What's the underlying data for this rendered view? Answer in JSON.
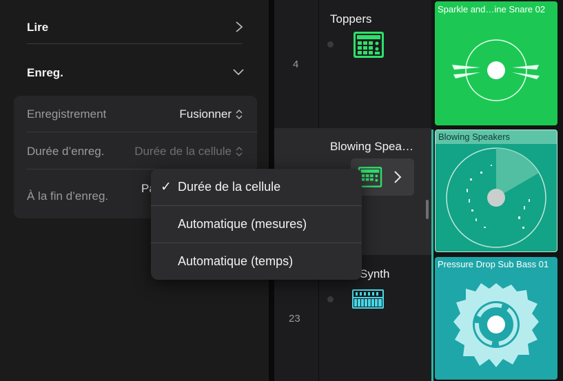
{
  "inspector": {
    "play_label": "Lire",
    "record_label": "Enreg.",
    "recording": {
      "label": "Enregistrement",
      "value": "Fusionner"
    },
    "duration": {
      "label": "Durée d’enreg.",
      "value": "Durée de la cellule"
    },
    "end": {
      "label": "À la fin d’enreg.",
      "value_partial": "Pa"
    }
  },
  "popup": {
    "options": [
      {
        "label": "Durée de la cellule",
        "checked": true
      },
      {
        "label": "Automatique (mesures)",
        "checked": false
      },
      {
        "label": "Automatique (temps)",
        "checked": false
      }
    ],
    "check_glyph": "✓"
  },
  "tracks": [
    {
      "number": "4",
      "name": "Toppers",
      "icon": "drum-machine-icon"
    },
    {
      "number": "",
      "name": "Blowing Spea…",
      "icon": "drum-machine-icon"
    },
    {
      "number": "23",
      "name": "Synth",
      "icon": "synth-keyboard-icon"
    }
  ],
  "cells": [
    {
      "title": "Sparkle and…ine Snare 02",
      "color": "#1cc853"
    },
    {
      "title": "Blowing Speakers",
      "color": "#13a386"
    },
    {
      "title": "Pressure Drop Sub Bass 01",
      "color": "#1fa6a9"
    }
  ],
  "colors": {
    "drum_icon": "#2ee06a",
    "synth_icon": "#46d7e6"
  }
}
